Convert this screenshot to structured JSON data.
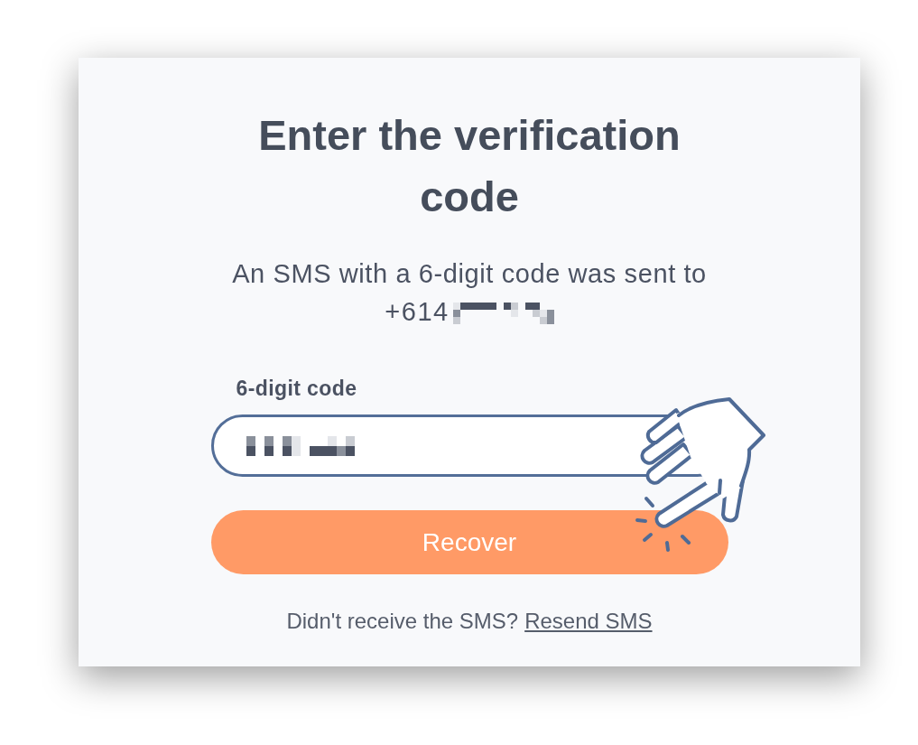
{
  "card": {
    "title": "Enter the verification code",
    "message": "An SMS with a 6-digit code was sent to",
    "phone_prefix": "+614"
  },
  "code_field": {
    "label": "6-digit code"
  },
  "submit_button": {
    "label": "Recover"
  },
  "footer": {
    "text": "Didn't receive the SMS?",
    "link": "Resend SMS"
  }
}
